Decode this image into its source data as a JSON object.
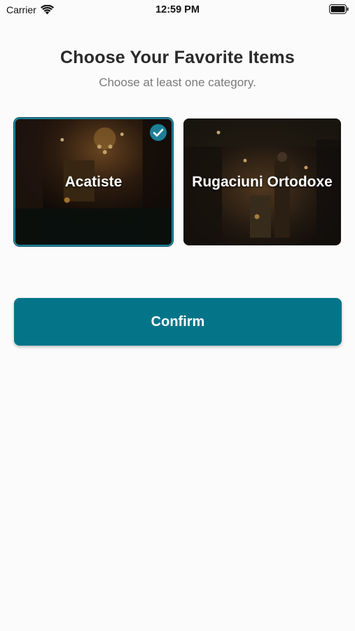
{
  "status_bar": {
    "carrier": "Carrier",
    "time": "12:59 PM",
    "icons": [
      "wifi-icon",
      "battery-icon"
    ]
  },
  "header": {
    "title": "Choose Your Favorite Items",
    "subtitle": "Choose at least one category."
  },
  "categories": [
    {
      "label": "Acatiste",
      "selected": true,
      "icon": "check-circle-icon"
    },
    {
      "label": "Rugaciuni Ortodoxe",
      "selected": false
    }
  ],
  "confirm_label": "Confirm",
  "colors": {
    "accent": "#047589",
    "selected_border": "#1c7f96",
    "background": "#fbfbfb",
    "title": "#2a2a2a",
    "subtitle": "#7a7a7a"
  }
}
